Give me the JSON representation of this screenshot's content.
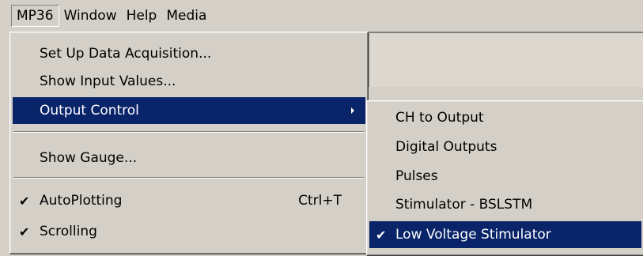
{
  "menubar": {
    "items": [
      "MP36",
      "Window",
      "Help",
      "Media"
    ]
  },
  "main_menu": {
    "items": [
      {
        "label": "Set Up Data Acquisition..."
      },
      {
        "label": "Show Input Values..."
      },
      {
        "label": "Output Control",
        "submenu": true,
        "highlighted": true
      },
      {
        "label": "Show Gauge..."
      },
      {
        "label": "AutoPlotting",
        "checked": true,
        "shortcut": "Ctrl+T"
      },
      {
        "label": "Scrolling",
        "checked": true
      }
    ]
  },
  "output_control_submenu": {
    "items": [
      {
        "label": "CH to Output"
      },
      {
        "label": "Digital Outputs"
      },
      {
        "label": "Pulses"
      },
      {
        "label": "Stimulator - BSLSTM"
      },
      {
        "label": "Low Voltage Stimulator",
        "checked": true,
        "highlighted": true
      }
    ]
  },
  "glyphs": {
    "check": "✔"
  },
  "colors": {
    "menu_bg": "#d4d0c8",
    "highlight": "#0a246a",
    "highlight_text": "#ffffff"
  }
}
